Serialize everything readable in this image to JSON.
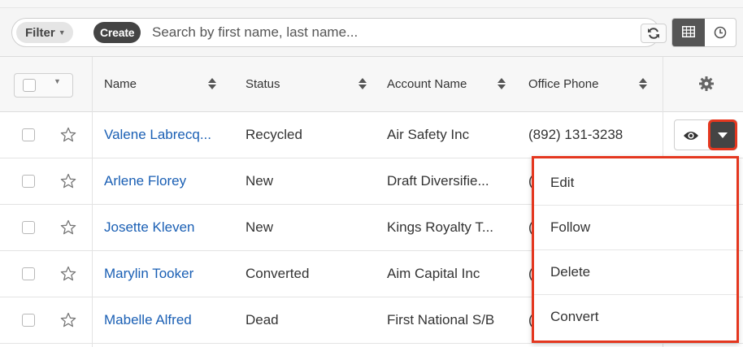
{
  "toolbar": {
    "filter_label": "Filter",
    "create_label": "Create",
    "search_placeholder": "Search by first name, last name..."
  },
  "header": {
    "columns": [
      "Name",
      "Status",
      "Account Name",
      "Office Phone"
    ]
  },
  "rows": [
    {
      "name": "Valene Labrecq...",
      "status": "Recycled",
      "account": "Air Safety Inc",
      "phone": "(892) 131-3238"
    },
    {
      "name": "Arlene Florey",
      "status": "New",
      "account": "Draft Diversifie...",
      "phone": "(..."
    },
    {
      "name": "Josette Kleven",
      "status": "New",
      "account": "Kings Royalty T...",
      "phone": "(..."
    },
    {
      "name": "Marylin Tooker",
      "status": "Converted",
      "account": "Aim Capital Inc",
      "phone": "(..."
    },
    {
      "name": "Mabelle Alfred",
      "status": "Dead",
      "account": "First National S/B",
      "phone": "(..."
    }
  ],
  "dropdown": {
    "items": [
      "Edit",
      "Follow",
      "Delete",
      "Convert"
    ]
  },
  "colors": {
    "link": "#1a5fb4",
    "highlight": "#e4371f",
    "dark_button": "#444444"
  }
}
